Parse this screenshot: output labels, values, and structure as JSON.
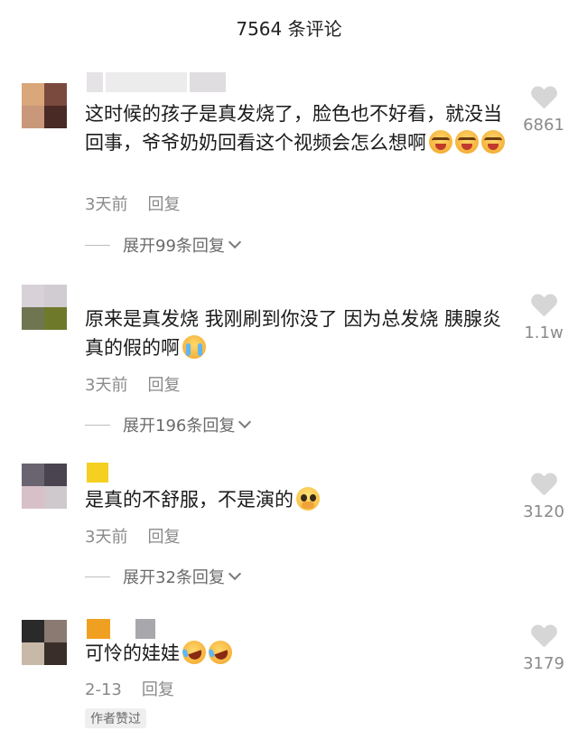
{
  "header": {
    "title": "7564 条评论"
  },
  "comments": [
    {
      "text": "这时候的孩子是真发烧了，脸色也不好看，就没当回事，爷爷奶奶回看这个视频会怎么想啊",
      "emojis": [
        "crying-face",
        "crying-face",
        "crying-face"
      ],
      "time": "3天前",
      "reply": "回复",
      "expand": "展开99条回复",
      "likes": "6861",
      "avatar_colors": [
        "#d9a77a",
        "#7a4a3f",
        "#c9987a",
        "#4a2a24"
      ]
    },
    {
      "text": "原来是真发烧 我刚刷到你没了 因为总发烧 胰腺炎 真的假的啊",
      "emojis": [
        "sobbing-face"
      ],
      "time": "3天前",
      "reply": "回复",
      "expand": "展开196条回复",
      "likes": "1.1w",
      "avatar_colors": [
        "#d8d2d8",
        "#d0ccd2",
        "#6f7550",
        "#6e7a2a"
      ]
    },
    {
      "text": "是真的不舒服，不是演的",
      "emojis": [
        "pleading-face"
      ],
      "time": "3天前",
      "reply": "回复",
      "expand": "展开32条回复",
      "likes": "3120",
      "avatar_colors": [
        "#6a6470",
        "#4a4450",
        "#d8c0c8",
        "#cfc8cc"
      ]
    },
    {
      "text": "可怜的娃娃",
      "emojis": [
        "laughing-tears-face",
        "laughing-tears-face"
      ],
      "time": "2-13",
      "reply": "回复",
      "badge": "作者赞过",
      "likes": "3179",
      "avatar_colors": [
        "#2a2a2a",
        "#8a7a72",
        "#c8b8a8",
        "#3a2e2a"
      ]
    }
  ]
}
